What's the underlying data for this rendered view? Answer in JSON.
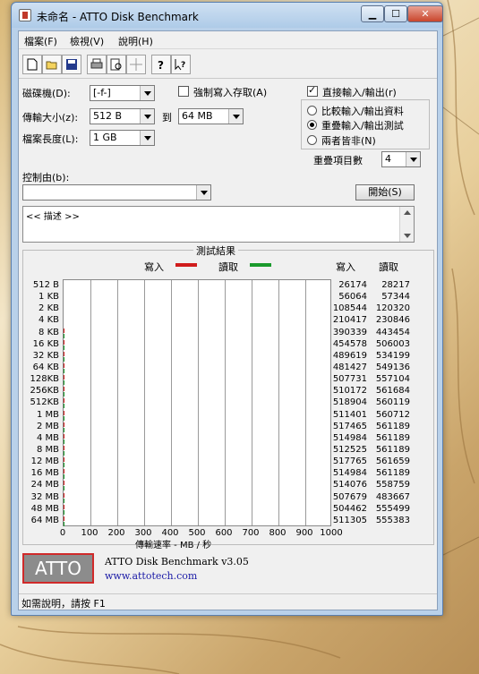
{
  "window": {
    "title": "未命名 - ATTO Disk Benchmark",
    "controls": {
      "minimize": "▁",
      "maximize": "☐",
      "close": "✕"
    }
  },
  "menu": [
    {
      "label": "檔案(F)"
    },
    {
      "label": "檢視(V)"
    },
    {
      "label": "說明(H)"
    }
  ],
  "toolbar_icons": [
    "new-file-icon",
    "open-folder-icon",
    "save-icon",
    "print-icon",
    "print-preview-icon",
    "move-icon",
    "help-icon",
    "context-help-icon"
  ],
  "settings": {
    "drive_label": "磁碟機(D):",
    "drive_value": "[-f-]",
    "force_write_label": "強制寫入存取(A)",
    "direct_io_label": "直接輸入/輸出(r)",
    "transfer_size_label": "傳輸大小(z):",
    "transfer_from": "512 B",
    "to_label": "到",
    "transfer_to": "64 MB",
    "file_length_label": "檔案長度(L):",
    "file_length_value": "1 GB",
    "radio_options": [
      {
        "label": "比較輸入/輸出資料",
        "selected": false
      },
      {
        "label": "重疊輸入/輸出測試",
        "selected": true
      },
      {
        "label": "兩者皆非(N)",
        "selected": false
      }
    ],
    "queue_depth_label": "重疊項目數",
    "queue_depth_value": "4",
    "controlled_by_label": "控制由(b):",
    "controlled_by_value": "",
    "start_button": "開始(S)",
    "description": "<< 描述 >>"
  },
  "results_title": "測試結果",
  "chart_data": {
    "type": "bar",
    "orientation": "horizontal",
    "legend_position": "top",
    "series": [
      {
        "name": "寫入",
        "color": "#d01c1c",
        "values": [
          26174,
          56064,
          108544,
          210417,
          390339,
          454578,
          489619,
          481427,
          507731,
          510172,
          518904,
          511401,
          517465,
          514984,
          512525,
          517765,
          514984,
          514076,
          507679,
          504462,
          511305
        ]
      },
      {
        "name": "讀取",
        "color": "#1a9a2c",
        "values": [
          28217,
          57344,
          120320,
          230846,
          443454,
          506003,
          534199,
          549136,
          557104,
          561684,
          560119,
          560712,
          561189,
          561189,
          561189,
          561659,
          561189,
          558759,
          483667,
          555499,
          555383
        ]
      }
    ],
    "categories": [
      "512 B",
      "1 KB",
      "2 KB",
      "4 KB",
      "8 KB",
      "16 KB",
      "32 KB",
      "64 KB",
      "128KB",
      "256KB",
      "512KB",
      "1 MB",
      "2 MB",
      "4 MB",
      "8 MB",
      "12 MB",
      "16 MB",
      "24 MB",
      "32 MB",
      "48 MB",
      "64 MB"
    ],
    "column_headers": {
      "write": "寫入",
      "read": "讀取"
    },
    "xlabel": "傳輸速率 - MB / 秒",
    "xlim": [
      0,
      1000
    ],
    "xticks": [
      "0",
      "100",
      "200",
      "300",
      "400",
      "500",
      "600",
      "700",
      "800",
      "900",
      "1000"
    ],
    "grid": true
  },
  "footer": {
    "logo_text": "ATTO",
    "product": "ATTO Disk Benchmark v3.05",
    "url": "www.attotech.com"
  },
  "status": "如需說明，請按 F1"
}
